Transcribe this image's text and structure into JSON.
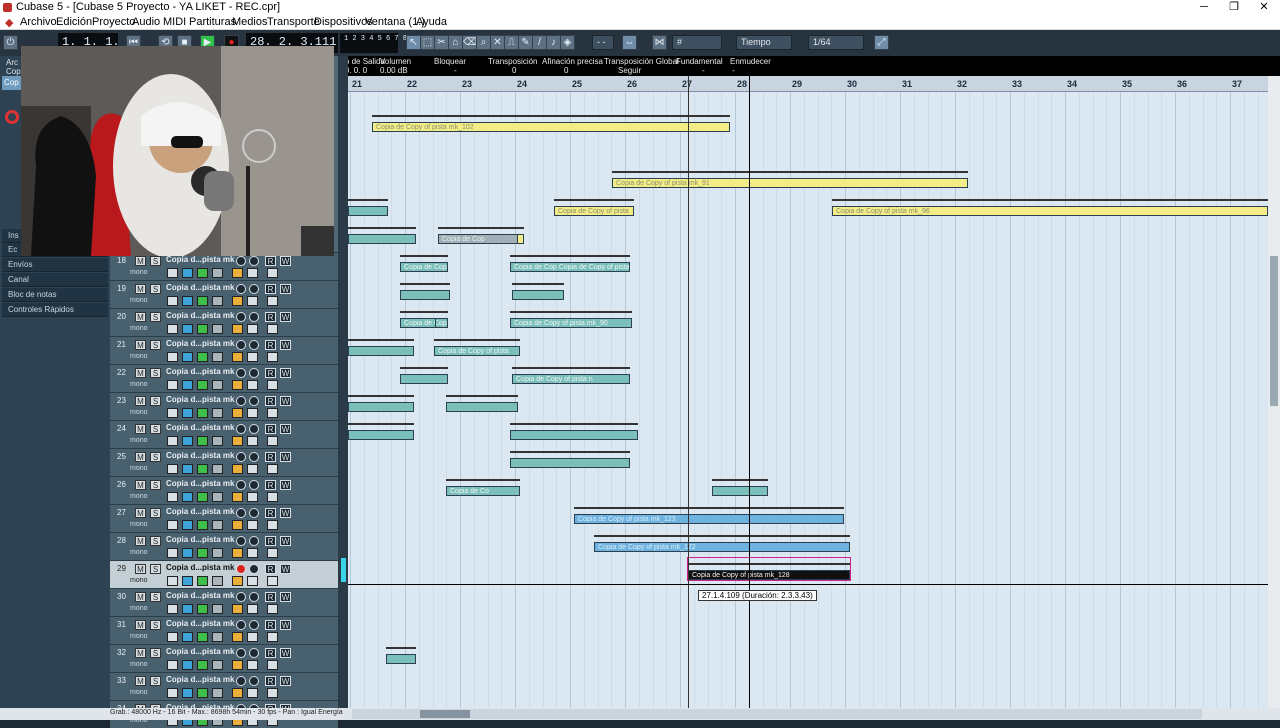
{
  "window": {
    "title": "Cubase 5 - [Cubase 5 Proyecto - YA LIKET - REC.cpr]"
  },
  "menu": [
    "Archivo",
    "Edición",
    "Proyecto",
    "Audio",
    "MIDI",
    "Partituras",
    "Medios",
    "Transporte",
    "Dispositivos",
    "Ventana (1.)",
    "Ayuda"
  ],
  "transport": {
    "position_left": "1. 1. 1.  0",
    "position_right": "28. 2. 3.111",
    "lcd_mini": "1 2 3 4 5 6 7 8 9 10"
  },
  "toolbar": {
    "grid_type": "Tiempo",
    "quantize": "1/64",
    "nudge": "- -"
  },
  "infoline": {
    "headers": [
      "...ido de Salida",
      "Volumen",
      "Bloquear",
      "Transposición",
      "Afinación precisa",
      "Transposición Global",
      "Fundamental",
      "Enmudecer"
    ],
    "values": [
      "0. 0. 0.  0",
      "0.00 dB",
      "-",
      "0",
      "0",
      "Seguir",
      "-",
      "-"
    ]
  },
  "inspector": {
    "top_labels": [
      "Arc",
      "Cop",
      "Cop"
    ],
    "items": [
      "Ins",
      "Ec",
      "Envíos",
      "Canal",
      "Bloc de notas",
      "Controles Rápidos"
    ]
  },
  "ruler": {
    "bars": [
      "21",
      "22",
      "23",
      "24",
      "25",
      "26",
      "27",
      "28",
      "29",
      "30",
      "31",
      "32",
      "33",
      "34",
      "35",
      "36",
      "37"
    ]
  },
  "tracks": [
    {
      "num": "18",
      "name": "Copia d...pista mk",
      "type": "mono"
    },
    {
      "num": "19",
      "name": "Copia d...pista mk",
      "type": "mono"
    },
    {
      "num": "20",
      "name": "Copia d...pista mk",
      "type": "mono"
    },
    {
      "num": "21",
      "name": "Copia d...pista mk",
      "type": "mono"
    },
    {
      "num": "22",
      "name": "Copia d...pista mk",
      "type": "mono"
    },
    {
      "num": "23",
      "name": "Copia d...pista mk",
      "type": "mono"
    },
    {
      "num": "24",
      "name": "Copia d...pista mk",
      "type": "mono"
    },
    {
      "num": "25",
      "name": "Copia d...pista mk",
      "type": "mono"
    },
    {
      "num": "26",
      "name": "Copia d...pista mk",
      "type": "mono"
    },
    {
      "num": "27",
      "name": "Copia d...pista mk",
      "type": "mono"
    },
    {
      "num": "28",
      "name": "Copia d...pista mk",
      "type": "mono"
    },
    {
      "num": "29",
      "name": "Copia d...pista mk",
      "type": "mono",
      "selected": true
    },
    {
      "num": "30",
      "name": "Copia d...pista mk",
      "type": "mono"
    },
    {
      "num": "31",
      "name": "Copia d...pista mk",
      "type": "mono"
    },
    {
      "num": "32",
      "name": "Copia d...pista mk",
      "type": "mono"
    },
    {
      "num": "33",
      "name": "Copia d...pista mk",
      "type": "mono"
    },
    {
      "num": "34",
      "name": "Copia d...pista mk",
      "type": "mono"
    }
  ],
  "events": [
    {
      "label": "Copia de Copy of pista mk_102",
      "color": "yellow"
    },
    {
      "label": "Copia de Copy of pista mk_91",
      "color": "yellow"
    },
    {
      "label": "Copia de Copy of pista",
      "color": "yellow"
    },
    {
      "label": "Copia de Copy of pista mk_96",
      "color": "yellow"
    },
    {
      "label": "Copia de",
      "color": "yellow"
    },
    {
      "label": "Copia de Cop",
      "color": "gray"
    },
    {
      "label": "Copia de Cop",
      "color": "teal"
    },
    {
      "label": "Copia de Cop  Copia de Copy of pista",
      "color": "teal"
    },
    {
      "label": "Copia de Cop",
      "color": "teal"
    },
    {
      "label": "Copia de C",
      "color": "teal"
    },
    {
      "label": "Copia de Copy of pista mk_90",
      "color": "teal"
    },
    {
      "label": "Copia de Copy of pista",
      "color": "teal"
    },
    {
      "label": "Copia de Copy of pista n",
      "color": "teal"
    },
    {
      "label": "Copia de Co",
      "color": "teal"
    },
    {
      "label": "Copia de Copy of pista mk_123",
      "color": "blue"
    },
    {
      "label": "Copia de Copy of pista mk_122",
      "color": "blue"
    },
    {
      "label": "Copia de Copy of pista mk_128",
      "color": "selected"
    }
  ],
  "tooltip": "27.1.4.109 (Duración: 2.3.3.43)",
  "statusbar": "Grab.: 48000 Hz - 16 Bit - Max.: 8698h 54min - 30 fps - Pan : Igual Energía",
  "colors": {
    "accent": "#6eb2df",
    "event_yellow": "#f4ec86",
    "event_teal": "#7bbfba",
    "background": "#dce8f1"
  }
}
